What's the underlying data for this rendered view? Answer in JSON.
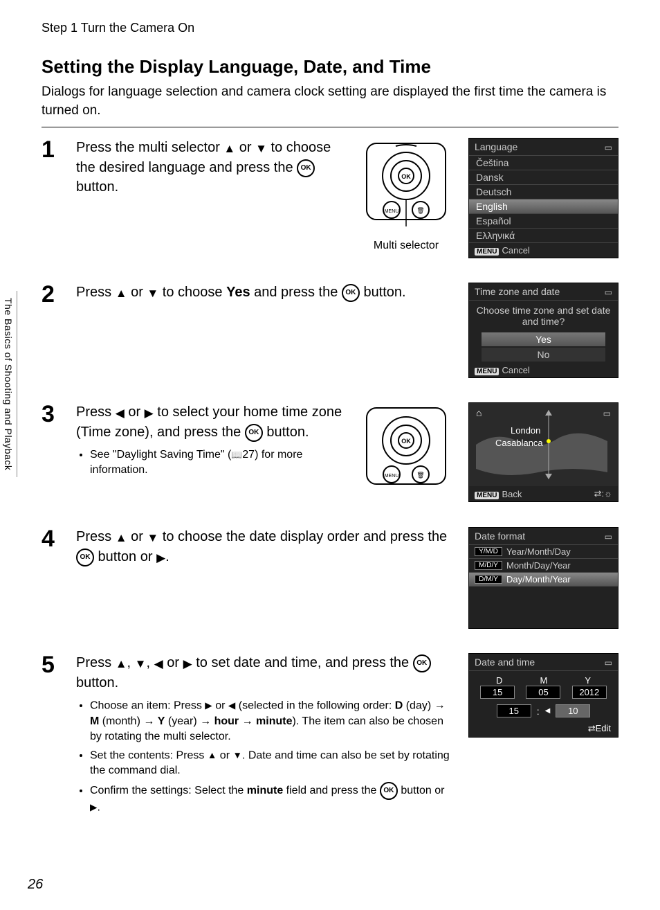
{
  "header": {
    "step_line": "Step 1 Turn the Camera On"
  },
  "section": {
    "title": "Setting the Display Language, Date, and Time",
    "intro": "Dialogs for language selection and camera clock setting are displayed the first time the camera is turned on."
  },
  "side_tab": "The Basics of Shooting and Playback",
  "page_number": "26",
  "step1": {
    "num": "1",
    "text_a": "Press the multi selector ",
    "text_b": " or ",
    "text_c": " to choose the desired language and press the ",
    "text_d": " button.",
    "selector_label": "Multi selector",
    "lcd": {
      "title": "Language",
      "items": [
        "Čeština",
        "Dansk",
        "Deutsch",
        "English",
        "Español",
        "Ελληνικά"
      ],
      "highlight_index": 3,
      "footer_label": "Cancel"
    }
  },
  "step2": {
    "num": "2",
    "text_a": "Press ",
    "text_b": " or ",
    "text_c": " to choose ",
    "yes_word": "Yes",
    "text_d": " and press the ",
    "text_e": " button.",
    "lcd": {
      "title": "Time zone and date",
      "prompt": "Choose time zone and set date and time?",
      "opt_yes": "Yes",
      "opt_no": "No",
      "footer_label": "Cancel"
    }
  },
  "step3": {
    "num": "3",
    "text_a": "Press ",
    "text_b": " or ",
    "text_c": " to select your home time zone (Time zone), and press the ",
    "text_d": " button.",
    "bullet_a": "See \"Daylight Saving Time\" (",
    "bullet_ref": "27",
    "bullet_b": ") for more information.",
    "lcd": {
      "city1": "London",
      "city2": "Casablanca",
      "footer_label": "Back"
    }
  },
  "step4": {
    "num": "4",
    "text_a": "Press ",
    "text_b": " or ",
    "text_c": " to choose the date display order and press the ",
    "text_d": " button or ",
    "text_e": ".",
    "lcd": {
      "title": "Date format",
      "rows": [
        {
          "badge": "Y/M/D",
          "label": "Year/Month/Day"
        },
        {
          "badge": "M/D/Y",
          "label": "Month/Day/Year"
        },
        {
          "badge": "D/M/Y",
          "label": "Day/Month/Year"
        }
      ],
      "highlight_index": 2
    }
  },
  "step5": {
    "num": "5",
    "text_a": "Press ",
    "text_sep": ", ",
    "text_b": " or ",
    "text_c": " to set date and time, and press the ",
    "text_d": " button.",
    "bullets": {
      "b1_a": "Choose an item: Press ",
      "b1_b": " or ",
      "b1_c": " (selected in the following order: ",
      "D": "D",
      "d_lbl": " (day) ",
      "M": "M",
      "m_lbl": " (month) ",
      "Y": "Y",
      "y_lbl": " (year) ",
      "hour": "hour",
      "minute": "minute",
      "b1_d": "). The item can also be chosen by rotating the multi selector.",
      "b2_a": "Set the contents: Press ",
      "b2_b": " or ",
      "b2_c": ". Date and time can also be set by rotating the command dial.",
      "b3_a": "Confirm the settings: Select the ",
      "b3_b": " field and press the ",
      "b3_c": " button or ",
      "b3_d": "."
    },
    "lcd": {
      "title": "Date and time",
      "labels": {
        "d": "D",
        "m": "M",
        "y": "Y"
      },
      "vals": {
        "d": "15",
        "m": "05",
        "y": "2012",
        "hh": "15",
        "mm": "10"
      },
      "edit": "Edit"
    }
  }
}
